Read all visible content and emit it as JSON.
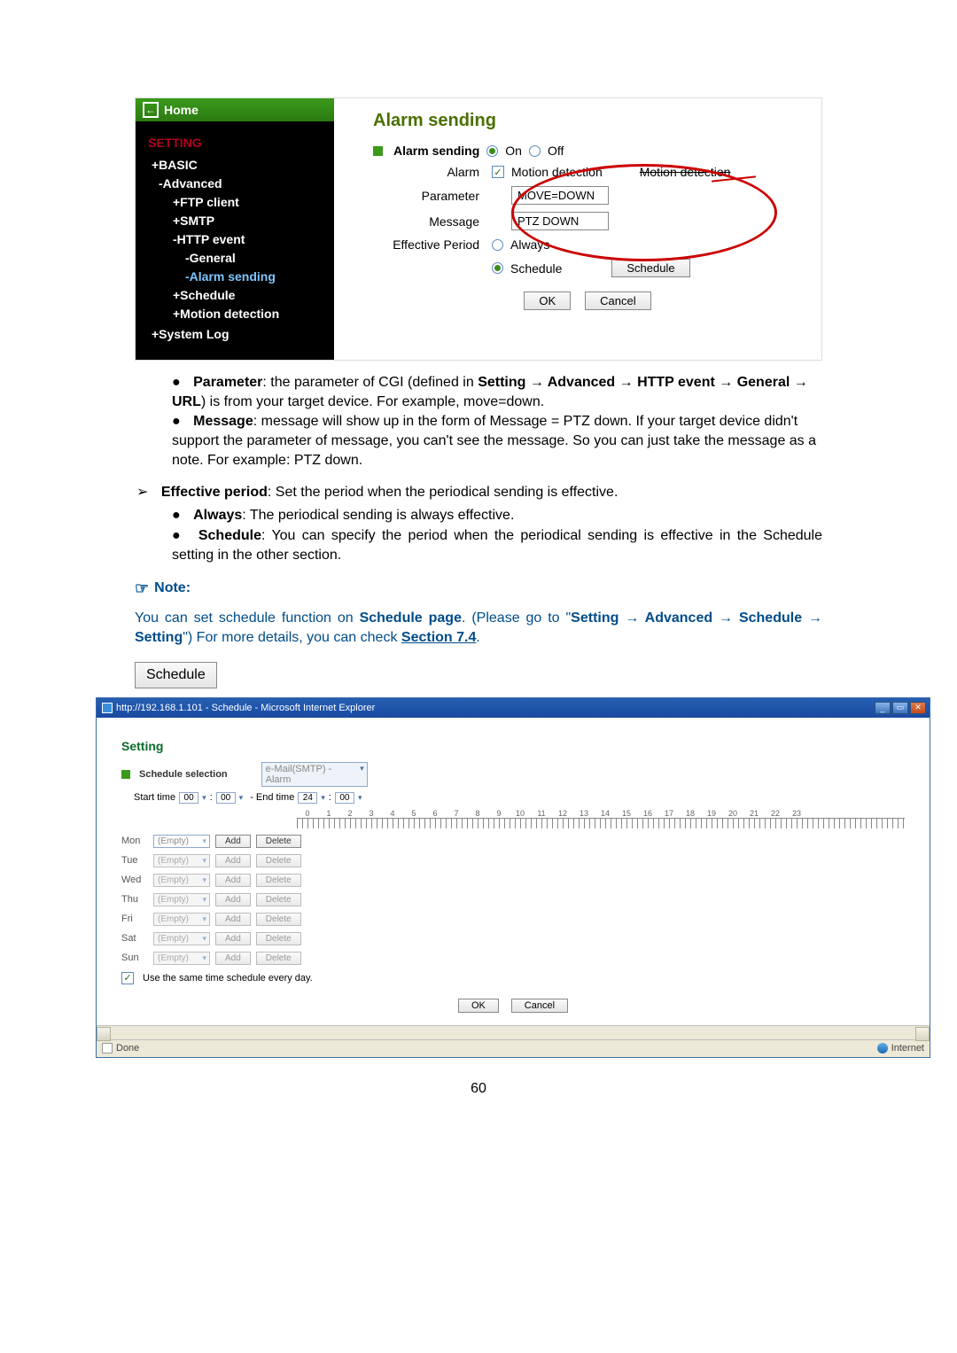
{
  "cam": {
    "home": "Home",
    "heading": "SETTING",
    "nav": {
      "basic": "+BASIC",
      "advanced": "-Advanced",
      "ftp": "+FTP client",
      "smtp": "+SMTP",
      "http": "-HTTP event",
      "general": "-General",
      "alarm": "-Alarm sending",
      "schedule": "+Schedule",
      "motion": "+Motion detection",
      "syslog": "+System Log"
    },
    "title": "Alarm sending",
    "row_alarm_sending": "Alarm sending",
    "on": "On",
    "off": "Off",
    "alarm_lbl": "Alarm",
    "motion_det": "Motion detection",
    "motion_det_strike": "Motion detection",
    "param_lbl": "Parameter",
    "param_val": "MOVE=DOWN",
    "msg_lbl": "Message",
    "msg_val": "PTZ DOWN",
    "eff_lbl": "Effective Period",
    "always": "Always",
    "schedule": "Schedule",
    "schedule_btn": "Schedule",
    "ok": "OK",
    "cancel": "Cancel"
  },
  "text": {
    "li_param": "Parameter",
    "li_param_body_a": ": the parameter of CGI (defined in ",
    "li_param_body_b": "Setting → Advanced → HTTP event → General → URL",
    "li_param_body_c": ") is from your target device. For example, move=down.",
    "li_msg": "Message",
    "li_msg_body": ": message will show up in the form of Message = PTZ down. If your target device didn't support the parameter of message, you can't see the message. So you can just take the message as a note. For example: PTZ down.",
    "ep_head": "Effective period",
    "ep_body": ": Set the period when the periodical sending is effective.",
    "li_always": "Always",
    "li_always_body": ": The periodical sending is always effective.",
    "li_sched": "Schedule",
    "li_sched_body": ": You can specify the period when the periodical sending is effective in the Schedule setting in the other section.",
    "note": "Note:",
    "note_para_a": "You can set schedule function on ",
    "note_para_b": "Schedule page",
    "note_para_c": ". (Please go to \"",
    "note_para_d": "Setting → Advanced → Schedule → Setting",
    "note_para_e": "\") For more details, you can check ",
    "note_para_f": "Section 7.4",
    "note_para_g": ".",
    "sched_btn": "Schedule"
  },
  "ie": {
    "title": "http://192.168.1.101 - Schedule - Microsoft Internet Explorer",
    "setting": "Setting",
    "schedule_selection": "Schedule selection",
    "sel_val": "e-Mail(SMTP) - Alarm",
    "start": "Start time",
    "end": "- End time",
    "h0": "00",
    "h24": "24",
    "empty": "(Empty)",
    "add": "Add",
    "delete": "Delete",
    "days": [
      "Mon",
      "Tue",
      "Wed",
      "Thu",
      "Fri",
      "Sat",
      "Sun"
    ],
    "use_same": "Use the same time schedule every day.",
    "ok": "OK",
    "cancel": "Cancel",
    "status_done": "Done",
    "status_internet": "Internet"
  },
  "hours": [
    "0",
    "1",
    "2",
    "3",
    "4",
    "5",
    "6",
    "7",
    "8",
    "9",
    "10",
    "11",
    "12",
    "13",
    "14",
    "15",
    "16",
    "17",
    "18",
    "19",
    "20",
    "21",
    "22",
    "23"
  ],
  "page_number": "60"
}
